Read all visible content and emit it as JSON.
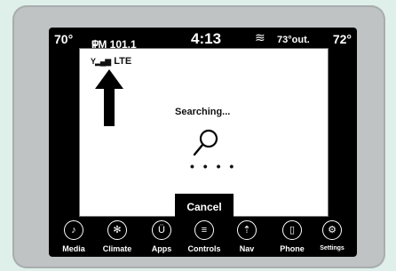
{
  "status": {
    "temp_left": "70°",
    "radio": "FM 101.1",
    "clock": "4:13",
    "outside_temp": "73°out.",
    "temp_right": "72°"
  },
  "dialog": {
    "signal": "LTE",
    "message": "Searching...",
    "progress_dots": "• • • •",
    "cancel_label": "Cancel"
  },
  "nav": [
    {
      "label": "Media",
      "icon": "music-note-icon",
      "glyph": "♪"
    },
    {
      "label": "Climate",
      "icon": "fan-icon",
      "glyph": "✻"
    },
    {
      "label": "Apps",
      "icon": "apps-u-icon",
      "glyph": "Ü"
    },
    {
      "label": "Controls",
      "icon": "controls-icon",
      "glyph": "≡"
    },
    {
      "label": "Nav",
      "icon": "compass-icon",
      "glyph": "⇡"
    },
    {
      "label": "Phone",
      "icon": "phone-icon",
      "glyph": "▯"
    },
    {
      "label": "Settings",
      "icon": "gear-icon",
      "glyph": "⚙"
    }
  ]
}
